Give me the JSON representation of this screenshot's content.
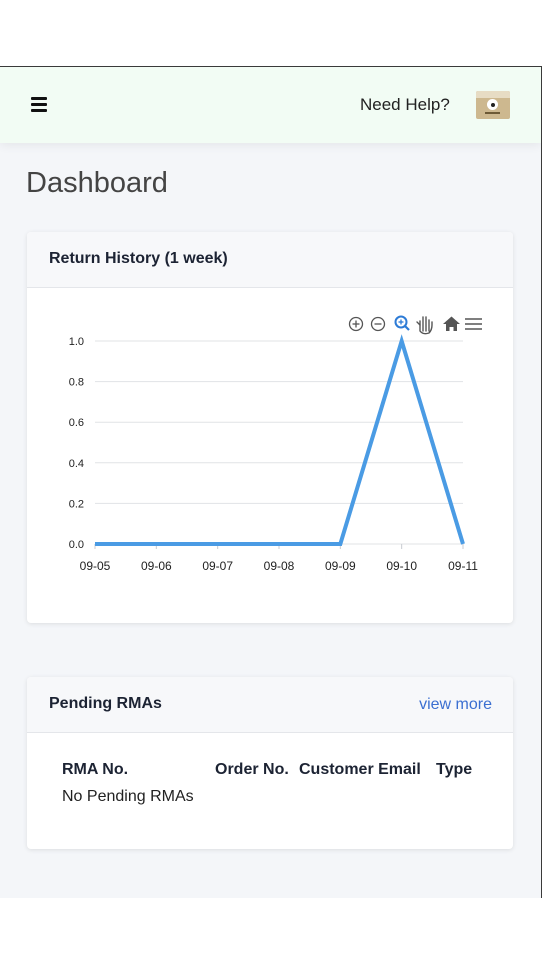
{
  "header": {
    "menu_icon": "hamburger-menu-icon",
    "help_label": "Need Help?",
    "avatar_icon": "camera-avatar-icon"
  },
  "page": {
    "title": "Dashboard"
  },
  "return_history": {
    "title": "Return History (1 week)",
    "toolbar_icons": [
      "zoom-in-icon",
      "zoom-out-icon",
      "selection-zoom-icon",
      "pan-hand-icon",
      "reset-zoom-home-icon",
      "chart-menu-icon"
    ],
    "chart_data": {
      "type": "line",
      "title": "",
      "xlabel": "",
      "ylabel": "",
      "x": [
        "09-05",
        "09-06",
        "09-07",
        "09-08",
        "09-09",
        "09-10",
        "09-11"
      ],
      "series": [
        {
          "values": [
            0,
            0,
            0,
            0,
            0,
            1,
            0
          ],
          "color": "#4a9be4"
        }
      ],
      "ylim": [
        0,
        1
      ],
      "yticks": [
        "0.0",
        "0.2",
        "0.4",
        "0.6",
        "0.8",
        "1.0"
      ],
      "grid": true
    }
  },
  "pending_rmas": {
    "title": "Pending RMAs",
    "view_more_label": "view more",
    "columns": [
      "RMA No.",
      "Order No.",
      "Customer Email",
      "Type"
    ],
    "empty_message": "No Pending RMAs"
  },
  "colors": {
    "header_bg": "#f2fcf4",
    "page_bg": "#f4f6f9",
    "line": "#4a9be4",
    "link": "#3b6fd1"
  }
}
